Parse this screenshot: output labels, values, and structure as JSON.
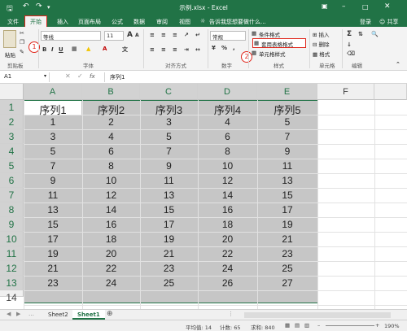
{
  "title": "示例.xlsx - Excel",
  "account": {
    "login": "登录",
    "share": "共享"
  },
  "tabs": [
    "文件",
    "开始",
    "插入",
    "页面布局",
    "公式",
    "数据",
    "审阅",
    "视图"
  ],
  "active_tab_index": 1,
  "tell_me": "告诉我您想要做什么...",
  "ribbon": {
    "clipboard": {
      "paste": "粘贴",
      "label": "剪贴板"
    },
    "font": {
      "name": "等线",
      "size": "11",
      "label": "字体",
      "font_glyph_a_large": "A",
      "font_glyph_a_small": "A",
      "wen": "文"
    },
    "alignment": {
      "label": "对齐方式"
    },
    "number": {
      "format": "常规",
      "percent": "%",
      "label": "数字"
    },
    "styles": {
      "conditional": "条件格式",
      "table_format": "套用表格格式",
      "cell_styles": "单元格样式",
      "label": "样式"
    },
    "cells": {
      "insert": "插入",
      "delete": "删除",
      "format": "格式",
      "label": "单元格"
    },
    "editing": {
      "sigma": "Σ",
      "label": "编辑"
    }
  },
  "markers": [
    "1",
    "2"
  ],
  "name_box": "A1",
  "fx": "fx",
  "formula_value": "序列1",
  "columns": [
    "A",
    "B",
    "C",
    "D",
    "E",
    "F"
  ],
  "rows": [
    "1",
    "2",
    "3",
    "4",
    "5",
    "6",
    "7",
    "8",
    "9",
    "10",
    "11",
    "12",
    "13",
    "14"
  ],
  "table": [
    [
      "序列1",
      "序列2",
      "序列3",
      "序列4",
      "序列5"
    ],
    [
      "1",
      "2",
      "3",
      "4",
      "5"
    ],
    [
      "3",
      "4",
      "5",
      "6",
      "7"
    ],
    [
      "5",
      "6",
      "7",
      "8",
      "9"
    ],
    [
      "7",
      "8",
      "9",
      "10",
      "11"
    ],
    [
      "9",
      "10",
      "11",
      "12",
      "13"
    ],
    [
      "11",
      "12",
      "13",
      "14",
      "15"
    ],
    [
      "13",
      "14",
      "15",
      "16",
      "17"
    ],
    [
      "15",
      "16",
      "17",
      "18",
      "19"
    ],
    [
      "17",
      "18",
      "19",
      "20",
      "21"
    ],
    [
      "19",
      "20",
      "21",
      "22",
      "23"
    ],
    [
      "21",
      "22",
      "23",
      "24",
      "25"
    ],
    [
      "23",
      "24",
      "25",
      "26",
      "27"
    ]
  ],
  "sheet_tabs": [
    "Sheet2",
    "Sheet1"
  ],
  "active_sheet": "Sheet1",
  "status": {
    "average": "平均值: 14",
    "count": "计数: 65",
    "sum": "求和: 840",
    "zoom": "190%"
  },
  "colors": {
    "accent": "#217346",
    "highlight": "#e0261b",
    "selection": "#c6c6c6"
  }
}
